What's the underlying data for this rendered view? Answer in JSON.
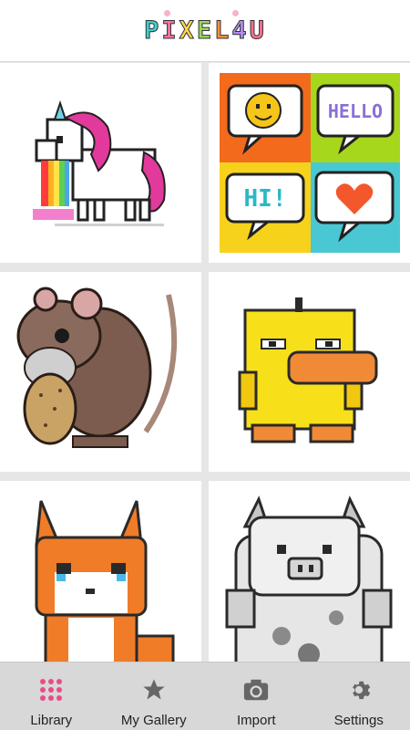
{
  "app": {
    "logo_letters": [
      "P",
      "I",
      "X",
      "E",
      "L",
      "4",
      "U"
    ],
    "logo_colors": [
      "#3ccfd0",
      "#ff6fa8",
      "#ffd64a",
      "#9ad85a",
      "#ff8f3d",
      "#b68cf0",
      "#ff6f91"
    ]
  },
  "tiles": [
    {
      "name": "unicorn-artwork"
    },
    {
      "name": "speech-bubbles-artwork",
      "texts": [
        "HELLO",
        "HI!"
      ]
    },
    {
      "name": "rat-artwork"
    },
    {
      "name": "duck-artwork"
    },
    {
      "name": "fox-artwork"
    },
    {
      "name": "pig-artwork"
    }
  ],
  "tabs": [
    {
      "label": "Library",
      "icon": "grid-dots-icon",
      "active": true
    },
    {
      "label": "My Gallery",
      "icon": "star-icon",
      "active": false
    },
    {
      "label": "Import",
      "icon": "camera-icon",
      "active": false
    },
    {
      "label": "Settings",
      "icon": "gear-icon",
      "active": false
    }
  ],
  "colors": {
    "active_tab": "#e84d8a",
    "inactive_tab": "#666666"
  }
}
